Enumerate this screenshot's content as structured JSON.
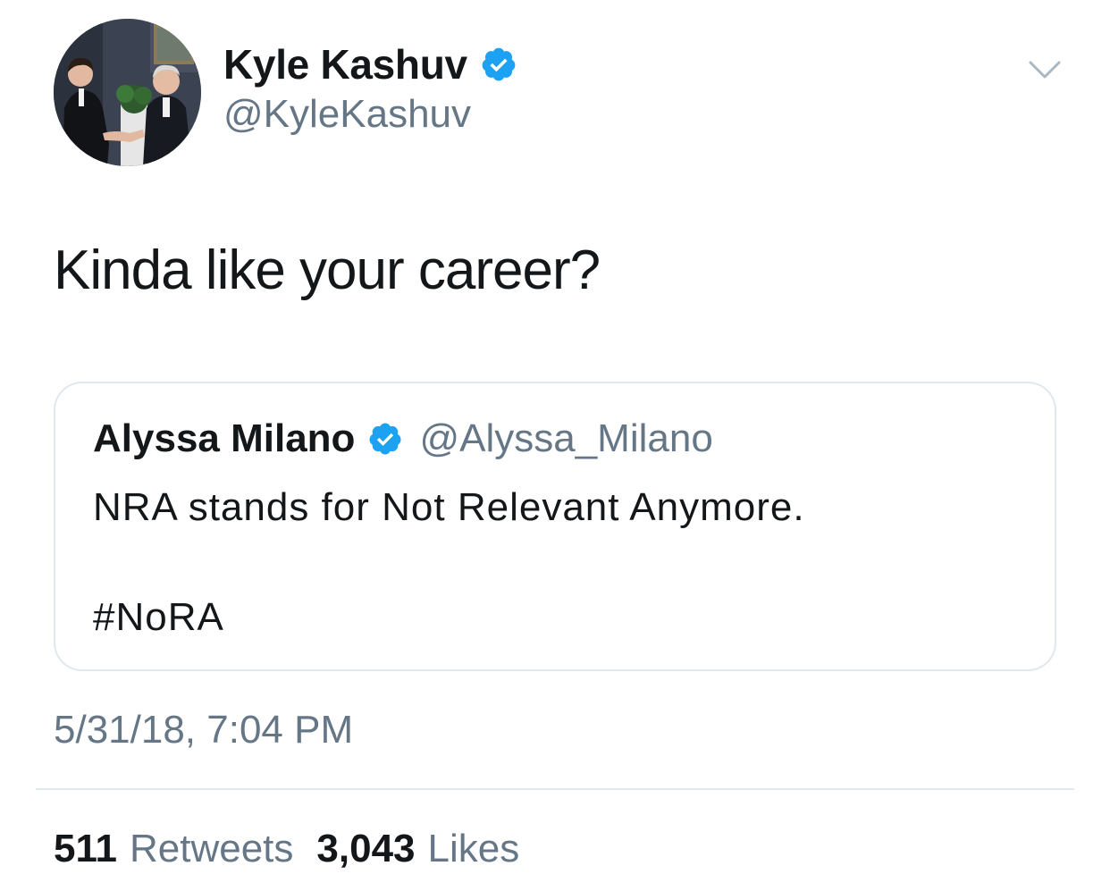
{
  "author": {
    "display_name": "Kyle Kashuv",
    "handle": "@KyleKashuv",
    "verified": true
  },
  "tweet": {
    "text": "Kinda like your career?",
    "timestamp": "5/31/18, 7:04 PM"
  },
  "quoted_tweet": {
    "display_name": "Alyssa Milano",
    "handle": "@Alyssa_Milano",
    "verified": true,
    "body": "NRA stands for Not Relevant Anymore.",
    "hashtag": "#NoRA"
  },
  "stats": {
    "retweets_count": "511",
    "retweets_label": "Retweets",
    "likes_count": "3,043",
    "likes_label": "Likes"
  },
  "icons": {
    "verified": "verified-badge-icon",
    "menu": "chevron-down-icon"
  },
  "colors": {
    "verified_blue": "#1da1f2",
    "secondary_text": "#657786",
    "primary_text": "#14171a",
    "border": "#e1e8ed"
  }
}
